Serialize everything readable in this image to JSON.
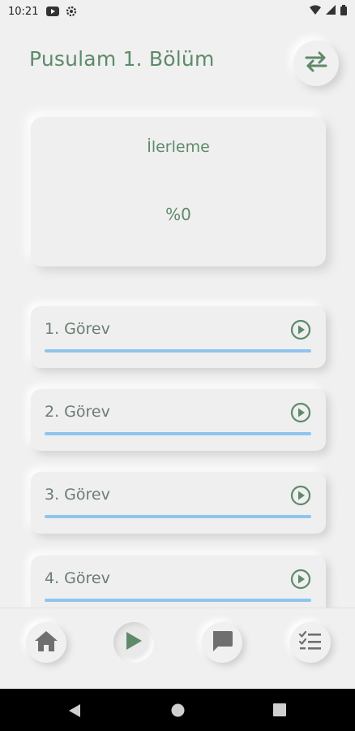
{
  "status_bar": {
    "time": "10:21"
  },
  "header": {
    "title": "Pusulam 1. Bölüm",
    "switch_icon": "swap-arrows-icon"
  },
  "progress": {
    "label": "İlerleme",
    "value_text": "%0",
    "percent": 0
  },
  "tasks": [
    {
      "label": "1. Görev",
      "progress": 0
    },
    {
      "label": "2. Görev",
      "progress": 0
    },
    {
      "label": "3. Görev",
      "progress": 0
    },
    {
      "label": "4. Görev",
      "progress": 0
    }
  ],
  "bottom_nav": [
    {
      "name": "home",
      "icon": "home-icon",
      "active": false
    },
    {
      "name": "play",
      "icon": "play-icon",
      "active": true
    },
    {
      "name": "chat",
      "icon": "chat-icon",
      "active": false
    },
    {
      "name": "tasks",
      "icon": "checklist-icon",
      "active": false
    }
  ],
  "colors": {
    "accent_green": "#5e8a6a",
    "progress_blue": "#8ec5ee",
    "background": "#f0f0f0"
  }
}
